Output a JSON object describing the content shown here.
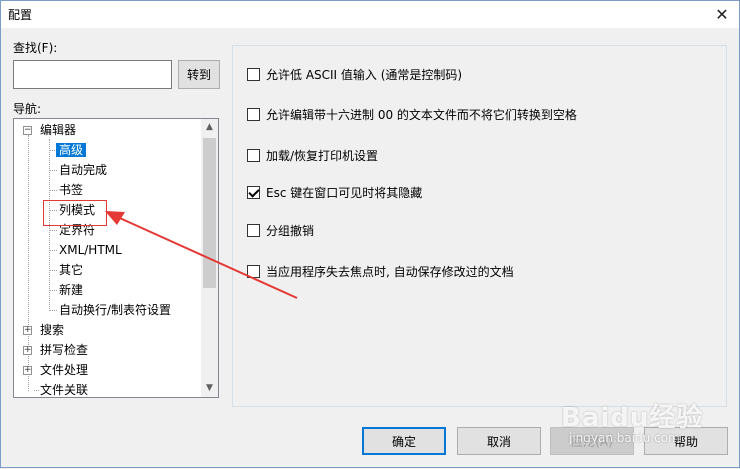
{
  "window": {
    "title": "配置",
    "close_glyph": "✕"
  },
  "search": {
    "label": "查找(F):",
    "value": "",
    "go_button": "转到"
  },
  "nav": {
    "label": "导航:",
    "items": [
      {
        "label": "编辑器",
        "expander": "−"
      },
      {
        "label": "高级"
      },
      {
        "label": "自动完成"
      },
      {
        "label": "书签"
      },
      {
        "label": "列模式"
      },
      {
        "label": "定界符"
      },
      {
        "label": "XML/HTML"
      },
      {
        "label": "其它"
      },
      {
        "label": "新建"
      },
      {
        "label": "自动换行/制表符设置"
      },
      {
        "label": "搜索",
        "expander": "+"
      },
      {
        "label": "拼写检查",
        "expander": "+"
      },
      {
        "label": "文件处理",
        "expander": "+"
      },
      {
        "label": "文件关联"
      }
    ],
    "scroll_up": "▲",
    "scroll_down": "▼"
  },
  "options": [
    {
      "label": "允许低 ASCII 值输入 (通常是控制码)",
      "checked": false
    },
    {
      "label": "允许编辑带十六进制 00 的文本文件而不将它们转换到空格",
      "checked": false
    },
    {
      "label": "加载/恢复打印机设置",
      "checked": false
    },
    {
      "label": "Esc 键在窗口可见时将其隐藏",
      "checked": true
    },
    {
      "label": "分组撤销",
      "checked": false
    },
    {
      "label": "当应用程序失去焦点时, 自动保存修改过的文档",
      "checked": false
    }
  ],
  "footer": {
    "ok": "确定",
    "cancel": "取消",
    "apply": "应用(A)",
    "help": "帮助"
  },
  "watermark": {
    "brand": "Baidu经验",
    "url": "jingyan.baidu.com"
  },
  "colors": {
    "accent": "#0078d7",
    "annotation": "#e53935"
  }
}
